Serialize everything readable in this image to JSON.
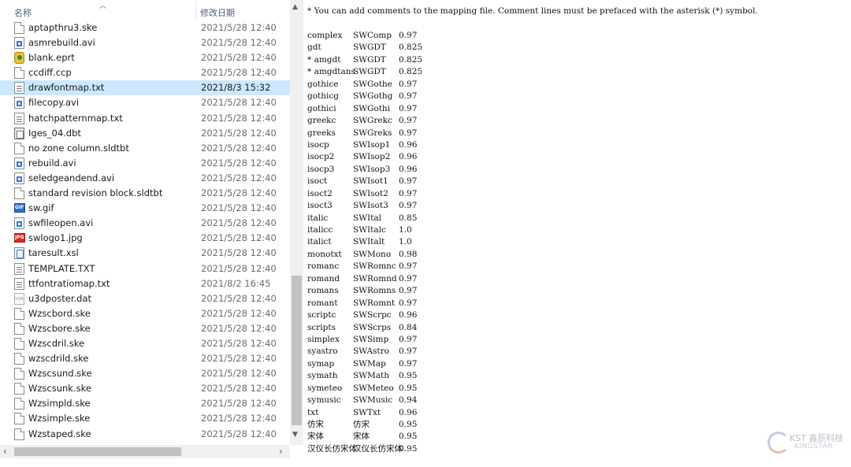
{
  "explorer": {
    "columns": {
      "name": "名称",
      "date": "修改日期"
    },
    "files": [
      {
        "name": "aptapthru3.ske",
        "date": "2021/5/28 12:40",
        "icon": "document-icon",
        "selected": false
      },
      {
        "name": "asmrebuild.avi",
        "date": "2021/5/28 12:40",
        "icon": "video-file-icon",
        "selected": false
      },
      {
        "name": "blank.eprt",
        "date": "2021/5/28 12:40",
        "icon": "edrawings-part-icon",
        "selected": false
      },
      {
        "name": "ccdiff.ccp",
        "date": "2021/5/28 12:40",
        "icon": "document-icon",
        "selected": false
      },
      {
        "name": "drawfontmap.txt",
        "date": "2021/8/3 15:32",
        "icon": "text-file-icon",
        "selected": true
      },
      {
        "name": "filecopy.avi",
        "date": "2021/5/28 12:40",
        "icon": "video-file-icon",
        "selected": false
      },
      {
        "name": "hatchpatternmap.txt",
        "date": "2021/5/28 12:40",
        "icon": "text-file-icon",
        "selected": false
      },
      {
        "name": "Iges_04.dbt",
        "date": "2021/5/28 12:40",
        "icon": "dbt-file-icon",
        "selected": false
      },
      {
        "name": "no zone column.sldtbt",
        "date": "2021/5/28 12:40",
        "icon": "document-icon",
        "selected": false
      },
      {
        "name": "rebuild.avi",
        "date": "2021/5/28 12:40",
        "icon": "video-file-icon",
        "selected": false
      },
      {
        "name": "seledgeandend.avi",
        "date": "2021/5/28 12:40",
        "icon": "video-file-icon",
        "selected": false
      },
      {
        "name": "standard revision block.sldtbt",
        "date": "2021/5/28 12:40",
        "icon": "document-icon",
        "selected": false
      },
      {
        "name": "sw.gif",
        "date": "2021/5/28 12:40",
        "icon": "gif-image-icon",
        "selected": false
      },
      {
        "name": "swfileopen.avi",
        "date": "2021/5/28 12:40",
        "icon": "video-file-icon",
        "selected": false
      },
      {
        "name": "swlogo1.jpg",
        "date": "2021/5/28 12:40",
        "icon": "jpg-image-icon",
        "selected": false
      },
      {
        "name": "taresult.xsl",
        "date": "2021/5/28 12:40",
        "icon": "xsl-file-icon",
        "selected": false
      },
      {
        "name": "TEMPLATE.TXT",
        "date": "2021/5/28 12:40",
        "icon": "text-file-icon",
        "selected": false
      },
      {
        "name": "ttfontratiomap.txt",
        "date": "2021/8/2 16:45",
        "icon": "text-file-icon",
        "selected": false
      },
      {
        "name": "u3dposter.dat",
        "date": "2021/5/28 12:40",
        "icon": "dat-file-icon",
        "selected": false
      },
      {
        "name": "Wzscbord.ske",
        "date": "2021/5/28 12:40",
        "icon": "document-icon",
        "selected": false
      },
      {
        "name": "Wzscbore.ske",
        "date": "2021/5/28 12:40",
        "icon": "document-icon",
        "selected": false
      },
      {
        "name": "Wzscdril.ske",
        "date": "2021/5/28 12:40",
        "icon": "document-icon",
        "selected": false
      },
      {
        "name": "wzscdrild.ske",
        "date": "2021/5/28 12:40",
        "icon": "document-icon",
        "selected": false
      },
      {
        "name": "Wzscsund.ske",
        "date": "2021/5/28 12:40",
        "icon": "document-icon",
        "selected": false
      },
      {
        "name": "Wzscsunk.ske",
        "date": "2021/5/28 12:40",
        "icon": "document-icon",
        "selected": false
      },
      {
        "name": "Wzsimpld.ske",
        "date": "2021/5/28 12:40",
        "icon": "document-icon",
        "selected": false
      },
      {
        "name": "Wzsimple.ske",
        "date": "2021/5/28 12:40",
        "icon": "document-icon",
        "selected": false
      },
      {
        "name": "Wzstaped.ske",
        "date": "2021/5/28 12:40",
        "icon": "document-icon",
        "selected": false
      }
    ],
    "selection_color": "#cce8ff"
  },
  "scrollbar": {
    "up_arrow": "▲",
    "down_arrow": "▼",
    "left_arrow": "‹",
    "right_arrow": "›"
  },
  "textfile": {
    "comment": "* You can add comments to the mapping file. Comment lines must be prefaced with the asterisk (*) symbol.",
    "mappings": [
      [
        "complex",
        "SWComp",
        "0.97"
      ],
      [
        "gdt",
        "SWGDT",
        "0.825"
      ],
      [
        "* amgdt",
        "SWGDT",
        "0.825"
      ],
      [
        "* amgdtans",
        "SWGDT",
        "0.825"
      ],
      [
        "gothice",
        "SWGothe",
        "0.97"
      ],
      [
        "gothicg",
        "SWGothg",
        "0.97"
      ],
      [
        "gothici",
        "SWGothi",
        "0.97"
      ],
      [
        "greekc",
        "SWGrekc",
        "0.97"
      ],
      [
        "greeks",
        "SWGreks",
        "0.97"
      ],
      [
        "isocp",
        "SWIsop1",
        "0.96"
      ],
      [
        "isocp2",
        "SWIsop2",
        "0.96"
      ],
      [
        "isocp3",
        "SWIsop3",
        "0.96"
      ],
      [
        "isoct",
        "SWIsot1",
        "0.97"
      ],
      [
        "isoct2",
        "SWIsot2",
        "0.97"
      ],
      [
        "isoct3",
        "SWIsot3",
        "0.97"
      ],
      [
        "italic",
        "SWItal",
        "0.85"
      ],
      [
        "italicc",
        "SWItalc",
        "1.0"
      ],
      [
        "italict",
        "SWItalt",
        "1.0"
      ],
      [
        "monotxt",
        "SWMono",
        "0.98"
      ],
      [
        "romanc",
        "SWRomnc",
        "0.97"
      ],
      [
        "romand",
        "SWRomnd",
        "0.97"
      ],
      [
        "romans",
        "SWRomns",
        "0.97"
      ],
      [
        "romant",
        "SWRomnt",
        "0.97"
      ],
      [
        "scriptc",
        "SWScrpc",
        "0.96"
      ],
      [
        "scripts",
        "SWScrps",
        "0.84"
      ],
      [
        "simplex",
        "SWSimp",
        "0.97"
      ],
      [
        "syastro",
        "SWAstro",
        "0.97"
      ],
      [
        "symap",
        "SWMap",
        "0.97"
      ],
      [
        "symath",
        "SWMath",
        "0.95"
      ],
      [
        "symeteo",
        "SWMeteo",
        "0.95"
      ],
      [
        "symusic",
        "SWMusic",
        "0.94"
      ],
      [
        "txt",
        "SWTxt",
        "0.96"
      ],
      [
        "仿宋",
        "仿宋",
        "0.95"
      ],
      [
        "宋体",
        "宋体",
        "0.95"
      ],
      [
        "汉仪长仿宋体",
        "汉仪长仿宋体",
        "0.95"
      ]
    ]
  },
  "watermark": {
    "line1": "KST 鑫辰科技",
    "line2": "KINGSTAR"
  }
}
